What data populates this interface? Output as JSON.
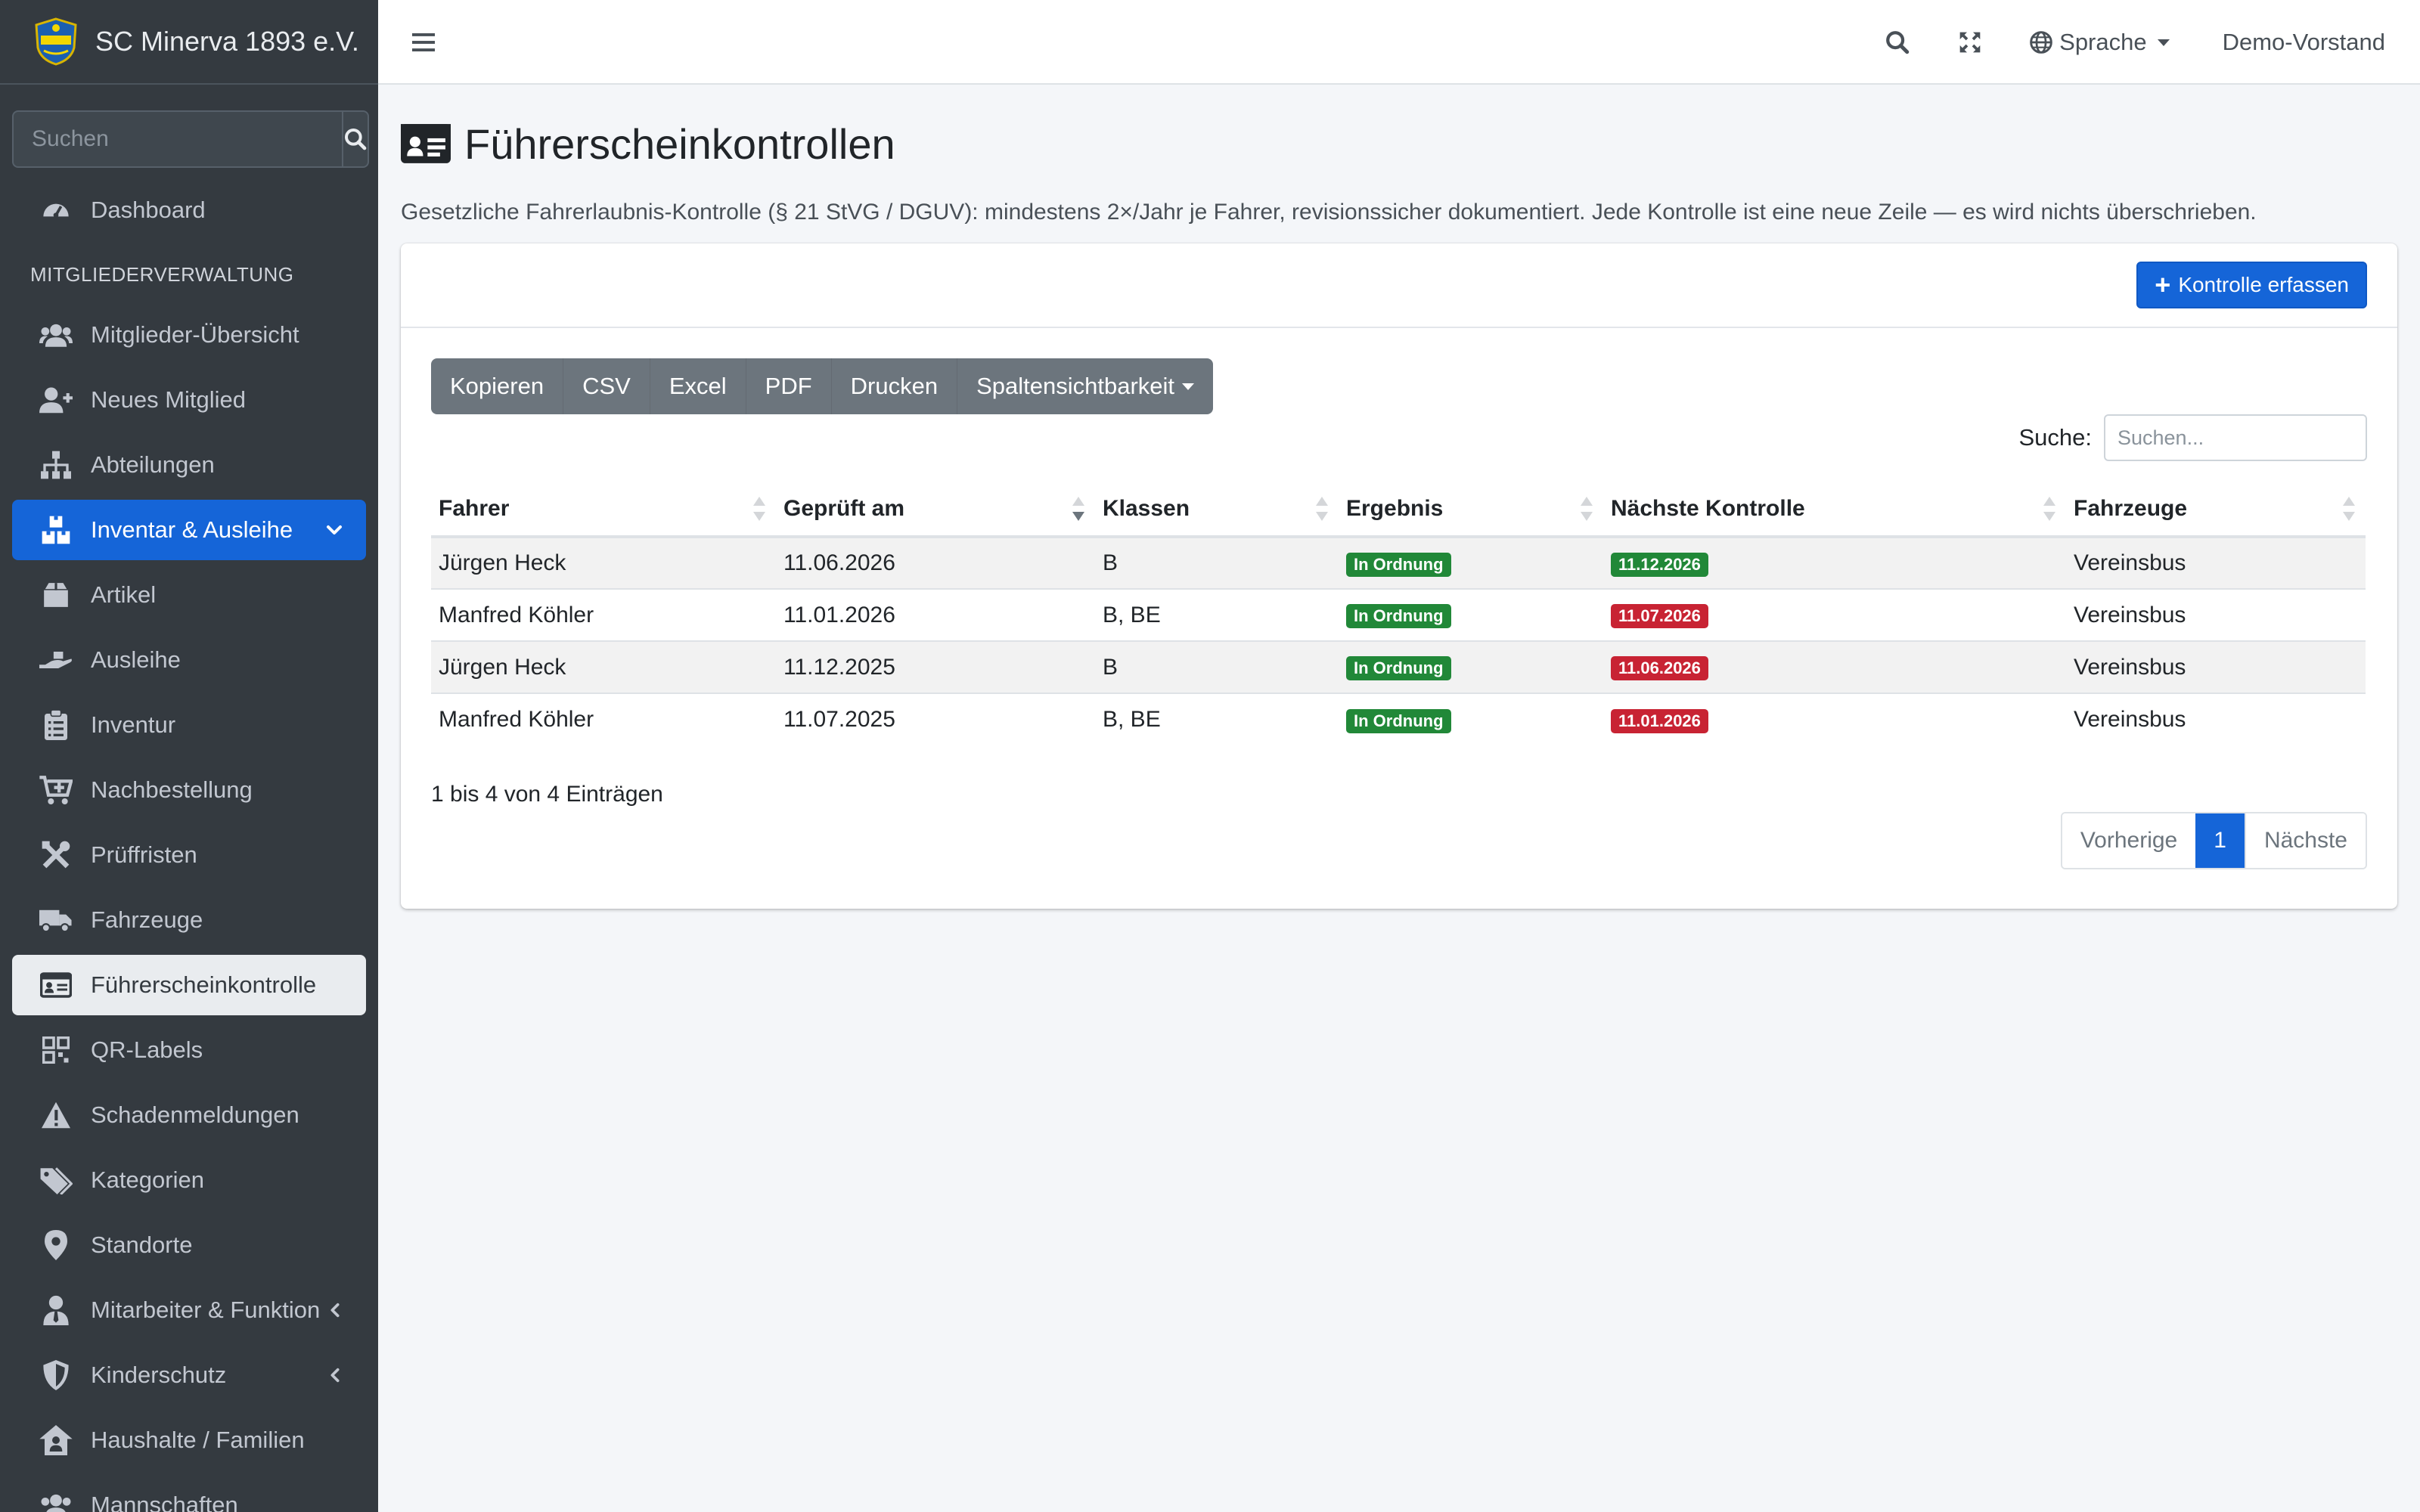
{
  "brand": {
    "name": "SC Minerva 1893 e.V."
  },
  "sidebar": {
    "search_placeholder": "Suchen",
    "items": [
      {
        "label": "Dashboard",
        "icon": "dashboard-gauge-icon"
      },
      {
        "header": "MITGLIEDERVERWALTUNG"
      },
      {
        "label": "Mitglieder-Übersicht",
        "icon": "users-icon"
      },
      {
        "label": "Neues Mitglied",
        "icon": "user-plus-icon"
      },
      {
        "label": "Abteilungen",
        "icon": "sitemap-icon"
      },
      {
        "label": "Inventar & Ausleihe",
        "icon": "boxes-icon",
        "state": "expanded-active"
      },
      {
        "label": "Artikel",
        "icon": "box-icon"
      },
      {
        "label": "Ausleihe",
        "icon": "hand-holding-icon"
      },
      {
        "label": "Inventur",
        "icon": "clipboard-list-icon"
      },
      {
        "label": "Nachbestellung",
        "icon": "cart-plus-icon"
      },
      {
        "label": "Prüffristen",
        "icon": "tools-icon"
      },
      {
        "label": "Fahrzeuge",
        "icon": "truck-icon"
      },
      {
        "label": "Führerscheinkontrolle",
        "icon": "id-card-icon",
        "state": "current"
      },
      {
        "label": "QR-Labels",
        "icon": "qrcode-icon"
      },
      {
        "label": "Schadenmeldungen",
        "icon": "warning-triangle-icon"
      },
      {
        "label": "Kategorien",
        "icon": "tags-icon"
      },
      {
        "label": "Standorte",
        "icon": "map-marker-icon"
      },
      {
        "label": "Mitarbeiter & Funktion",
        "icon": "user-tie-icon"
      },
      {
        "label": "Kinderschutz",
        "icon": "shield-icon"
      },
      {
        "label": "Haushalte / Familien",
        "icon": "house-user-icon"
      },
      {
        "label": "Mannschaften",
        "icon": "team-icon"
      }
    ]
  },
  "topbar": {
    "language": "Sprache",
    "user": "Demo-Vorstand"
  },
  "page": {
    "title": "Führerscheinkontrollen",
    "lead": "Gesetzliche Fahrerlaubnis-Kontrolle (§ 21 StVG / DGUV): mindestens 2×/Jahr je Fahrer, revisionssicher dokumentiert. Jede Kontrolle ist eine neue Zeile — es wird nichts überschrieben.",
    "add_button": "Kontrolle erfassen"
  },
  "toolbar": {
    "buttons": [
      "Kopieren",
      "CSV",
      "Excel",
      "PDF",
      "Drucken",
      "Spaltensichtbarkeit"
    ]
  },
  "table": {
    "search_label": "Suche:",
    "search_placeholder": "Suchen...",
    "columns": [
      "Fahrer",
      "Geprüft am",
      "Klassen",
      "Ergebnis",
      "Nächste Kontrolle",
      "Fahrzeuge"
    ],
    "rows": [
      {
        "fahrer": "Jürgen Heck",
        "geprueft": "11.06.2026",
        "klassen": "B",
        "ergebnis": "In Ordnung",
        "naechste": "11.12.2026",
        "naechste_status": "ok",
        "fahrzeuge": "Vereinsbus"
      },
      {
        "fahrer": "Manfred Köhler",
        "geprueft": "11.01.2026",
        "klassen": "B, BE",
        "ergebnis": "In Ordnung",
        "naechste": "11.07.2026",
        "naechste_status": "overdue",
        "fahrzeuge": "Vereinsbus"
      },
      {
        "fahrer": "Jürgen Heck",
        "geprueft": "11.12.2025",
        "klassen": "B",
        "ergebnis": "In Ordnung",
        "naechste": "11.06.2026",
        "naechste_status": "overdue",
        "fahrzeuge": "Vereinsbus"
      },
      {
        "fahrer": "Manfred Köhler",
        "geprueft": "11.07.2025",
        "klassen": "B, BE",
        "ergebnis": "In Ordnung",
        "naechste": "11.01.2026",
        "naechste_status": "overdue",
        "fahrzeuge": "Vereinsbus"
      }
    ],
    "info": "1 bis 4 von 4 Einträgen",
    "pager": {
      "prev": "Vorherige",
      "current": "1",
      "next": "Nächste"
    }
  },
  "colors": {
    "primary": "#1565d8",
    "sidebar": "#343a40",
    "success": "#218838",
    "danger": "#c82333"
  }
}
